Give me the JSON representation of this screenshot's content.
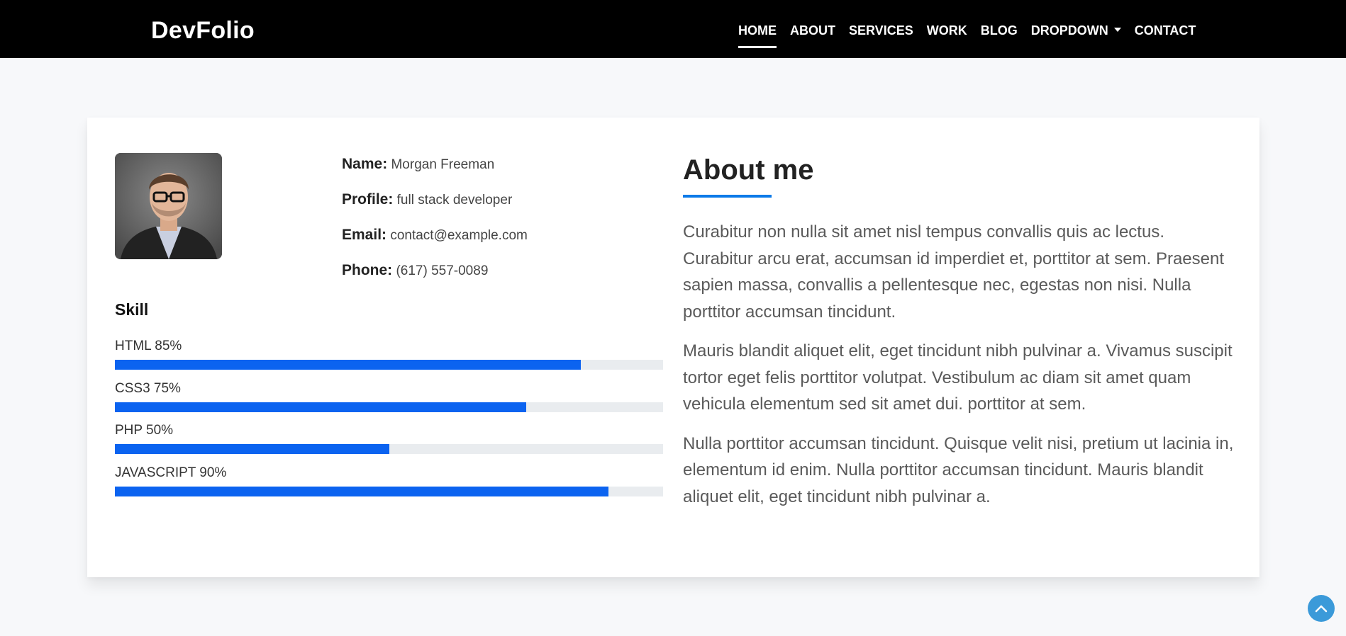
{
  "brand": "DevFolio",
  "nav": [
    {
      "label": "HOME"
    },
    {
      "label": "ABOUT"
    },
    {
      "label": "SERVICES"
    },
    {
      "label": "WORK"
    },
    {
      "label": "BLOG"
    },
    {
      "label": "DROPDOWN"
    },
    {
      "label": "CONTACT"
    }
  ],
  "profile": {
    "name_key": "Name:",
    "name": "Morgan Freeman",
    "profile_key": "Profile:",
    "profile": "full stack developer",
    "email_key": "Email:",
    "email": "contact@example.com",
    "phone_key": "Phone:",
    "phone": "(617) 557-0089"
  },
  "skills": {
    "title": "Skill",
    "items": [
      {
        "label": "HTML 85%",
        "value": 85
      },
      {
        "label": "CSS3 75%",
        "value": 75
      },
      {
        "label": "PHP 50%",
        "value": 50
      },
      {
        "label": "JAVASCRIPT 90%",
        "value": 90
      }
    ]
  },
  "about": {
    "title": "About me",
    "paragraphs": [
      "Curabitur non nulla sit amet nisl tempus convallis quis ac lectus. Curabitur arcu erat, accumsan id imperdiet et, porttitor at sem. Praesent sapien massa, convallis a pellentesque nec, egestas non nisi. Nulla porttitor accumsan tincidunt.",
      "Mauris blandit aliquet elit, eget tincidunt nibh pulvinar a. Vivamus suscipit tortor eget felis porttitor volutpat. Vestibulum ac diam sit amet quam vehicula elementum sed sit amet dui. porttitor at sem.",
      "Nulla porttitor accumsan tincidunt. Quisque velit nisi, pretium ut lacinia in, elementum id enim. Nulla porttitor accumsan tincidunt. Mauris blandit aliquet elit, eget tincidunt nibh pulvinar a."
    ]
  },
  "colors": {
    "accent": "#0b63f0",
    "about_underline": "#0b7ae8",
    "back_to_top": "#3b9ad9"
  },
  "icons": {
    "back_to_top": "chevron-up-icon",
    "dropdown": "caret-down-icon"
  }
}
